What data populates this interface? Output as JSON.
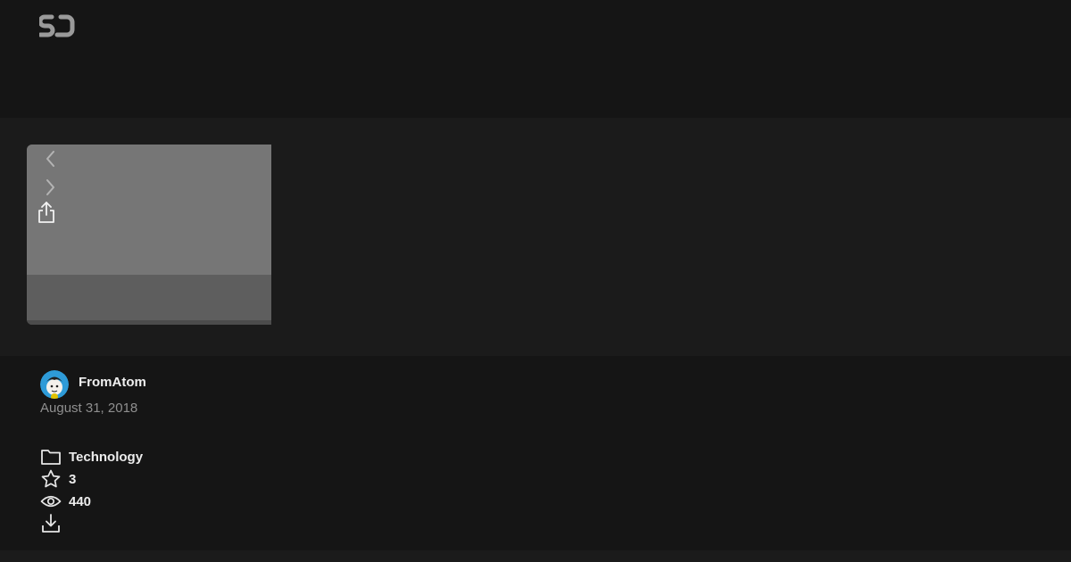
{
  "brand": {
    "logo_text": "SJ"
  },
  "viewer": {
    "prev_icon": "chevron-left-icon",
    "next_icon": "chevron-right-icon",
    "share_icon": "share-icon"
  },
  "post": {
    "author": "FromAtom",
    "date": "August 31, 2018",
    "category": "Technology",
    "stars": "3",
    "views": "440"
  },
  "icons": {
    "category": "folder-icon",
    "stars": "star-icon",
    "views": "eye-icon",
    "download": "download-icon"
  },
  "colors": {
    "background": "#151515",
    "stage": "#1b1b1b",
    "slide": "#767676",
    "muted_text": "#8f8f8f"
  }
}
